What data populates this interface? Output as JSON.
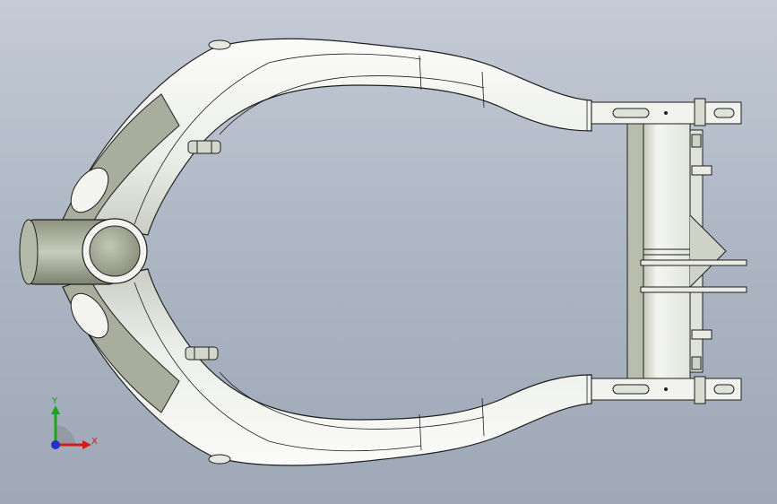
{
  "viewport": {
    "background_top": "#c4cbd6",
    "background_bottom": "#9ea8b6"
  },
  "model": {
    "body_fill": "#eef0ee",
    "shade_fill": "#a8ad9d",
    "edge_color": "#1e1e1e"
  },
  "triad": {
    "y_label": "Y",
    "x_label": "X",
    "y_color": "#1aa51a",
    "x_color": "#d41c1c",
    "z_color": "#2233cc"
  }
}
